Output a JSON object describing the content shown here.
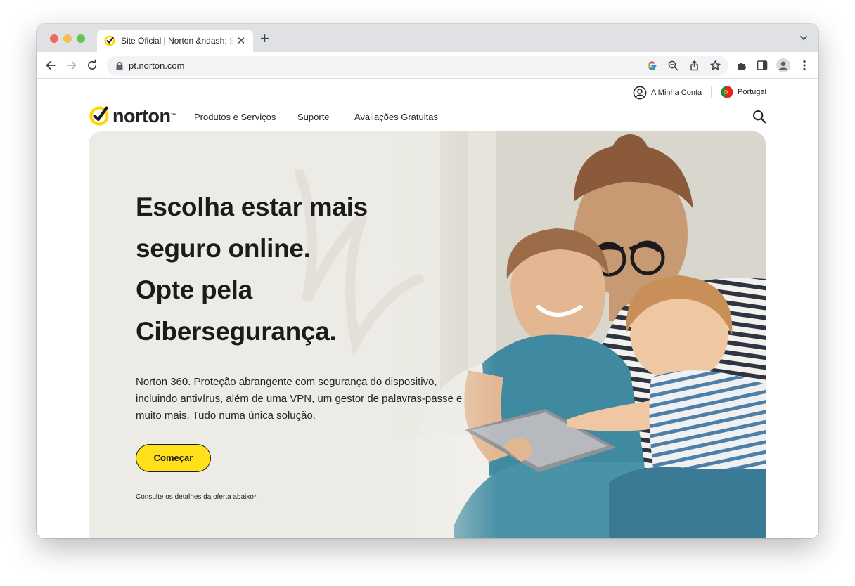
{
  "browser": {
    "tab_title": "Site Oficial | Norton &ndash; Soluções de Cibersegurança",
    "url": "pt.norton.com"
  },
  "site": {
    "account_label": "A Minha Conta",
    "country_label": "Portugal",
    "logo_text": "norton",
    "logo_tm": "™",
    "nav": {
      "products": "Produtos e Serviços",
      "support": "Suporte",
      "trials": "Avaliações Gratuitas"
    }
  },
  "hero": {
    "headline_lines": [
      "Escolha estar mais",
      "seguro online.",
      "Opte pela",
      "Cibersegurança."
    ],
    "description_lines": [
      "Norton 360. Proteção abrangente com segurança do dispositivo,",
      "incluindo antivírus, além de uma VPN, um gestor de palavras-passe e",
      "muito mais. Tudo numa única solução."
    ],
    "cta_label": "Começar",
    "offer_note": "Consulte os detalhes da oferta abaixo*"
  },
  "colors": {
    "brand_yellow": "#ffe01b",
    "text_dark": "#1b1b1b"
  },
  "icons": [
    "norton-check-icon",
    "account-icon",
    "portugal-flag-icon",
    "search-icon",
    "lock-icon",
    "google-icon",
    "zoom-icon",
    "share-icon",
    "bookmark-star-icon",
    "extensions-icon",
    "sidepanel-icon",
    "profile-icon",
    "menu-icon"
  ]
}
